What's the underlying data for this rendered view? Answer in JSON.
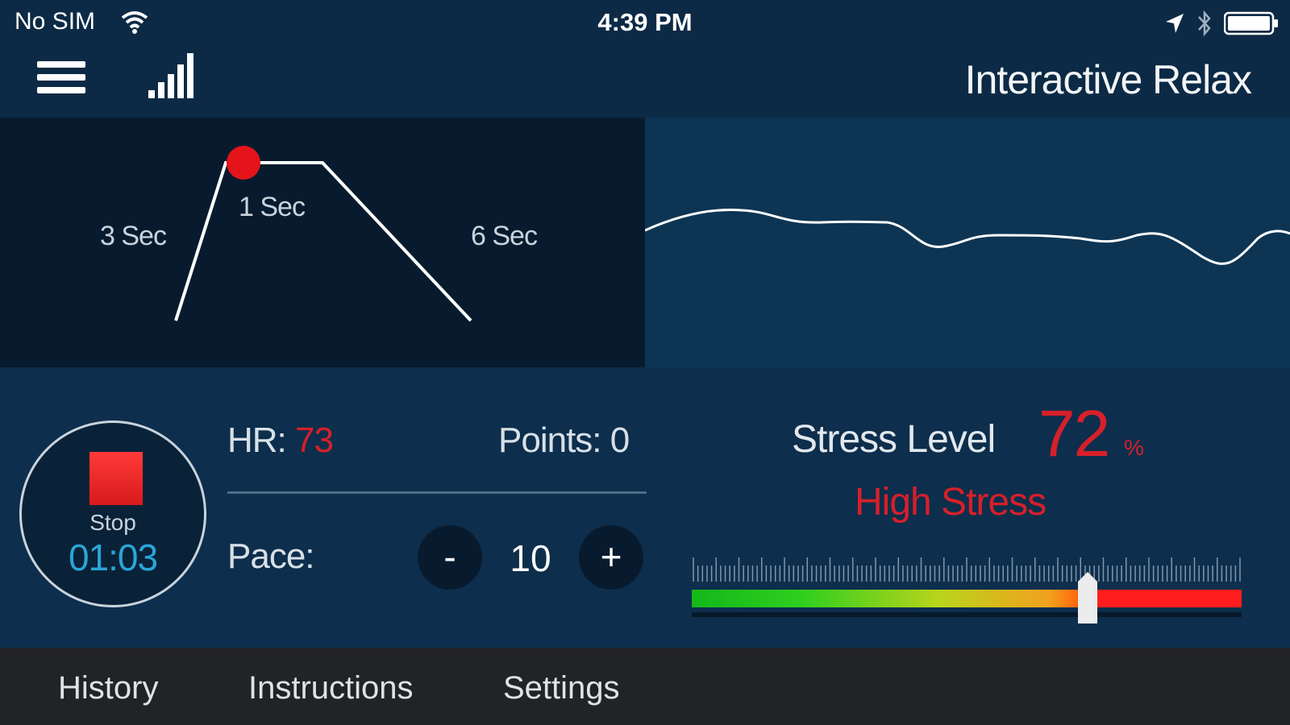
{
  "status_bar": {
    "carrier": "No SIM",
    "time": "4:39 PM",
    "icons": [
      "wifi-icon",
      "location-arrow-icon",
      "bluetooth-icon",
      "battery-icon"
    ]
  },
  "nav": {
    "title": "Interactive Relax",
    "icons": [
      "menu-icon",
      "signal-bars-icon"
    ]
  },
  "breathing": {
    "inhale_label": "3 Sec",
    "hold_label": "1 Sec",
    "exhale_label": "6 Sec"
  },
  "session": {
    "stop_label": "Stop",
    "timer": "01:03",
    "hr_label": "HR:",
    "hr_value": "73",
    "points_label": "Points: 0",
    "pace_label": "Pace:",
    "pace_minus": "-",
    "pace_value": "10",
    "pace_plus": "+"
  },
  "stress": {
    "label": "Stress Level",
    "value": "72",
    "unit": "%",
    "status": "High Stress",
    "gauge_fraction": 0.72
  },
  "tabs": [
    {
      "label": "History"
    },
    {
      "label": "Instructions"
    },
    {
      "label": "Settings"
    }
  ],
  "colors": {
    "background": "#0c2a45",
    "accent_red": "#d6202a",
    "timer_blue": "#2aa5d8",
    "tab_bar": "#222325"
  }
}
